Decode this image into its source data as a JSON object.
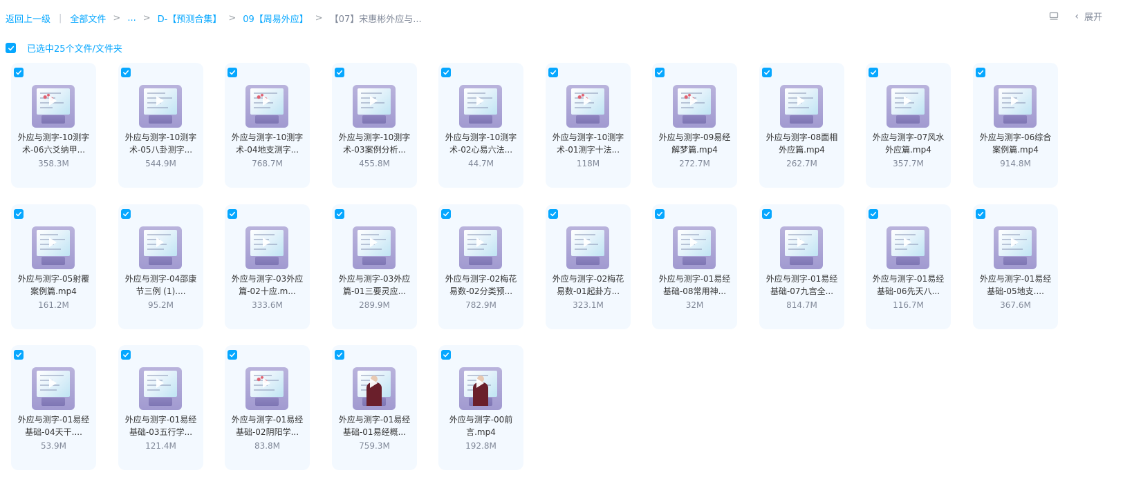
{
  "breadcrumb": {
    "back": "返回上一级",
    "all_files": "全部文件",
    "ellipsis": "...",
    "folder1": "D-【预测合集】",
    "folder2": "09【周易外应】",
    "current": "【07】宋惠彬外应与..."
  },
  "toolbar": {
    "collapse_label": "展开",
    "list_view_icon": "list-view-icon",
    "collapse_icon": "chevron-left-icon"
  },
  "selection": {
    "label": "已选中25个文件/文件夹",
    "checked": true
  },
  "colors": {
    "accent": "#06a7ff",
    "card_bg": "#f3f9ff",
    "muted": "#818999"
  },
  "files": [
    {
      "name": "外应与测字-10测字术-06六爻纳甲...",
      "size": "358.3M",
      "thumb": "slide-red"
    },
    {
      "name": "外应与测字-10测字术-05八卦测字...",
      "size": "544.9M",
      "thumb": "slide-play"
    },
    {
      "name": "外应与测字-10测字术-04地支测字...",
      "size": "768.7M",
      "thumb": "slide-red"
    },
    {
      "name": "外应与测字-10测字术-03案例分析...",
      "size": "455.8M",
      "thumb": "slide-play"
    },
    {
      "name": "外应与测字-10测字术-02心易六法...",
      "size": "44.7M",
      "thumb": "slide"
    },
    {
      "name": "外应与测字-10测字术-01测字十法...",
      "size": "118M",
      "thumb": "slide-red"
    },
    {
      "name": "外应与测字-09易经解梦篇.mp4",
      "size": "272.7M",
      "thumb": "slide-red"
    },
    {
      "name": "外应与测字-08面相外应篇.mp4",
      "size": "262.7M",
      "thumb": "slide-play"
    },
    {
      "name": "外应与测字-07风水外应篇.mp4",
      "size": "357.7M",
      "thumb": "slide"
    },
    {
      "name": "外应与测字-06综合案例篇.mp4",
      "size": "914.8M",
      "thumb": "slide"
    },
    {
      "name": "外应与测字-05射覆案例篇.mp4",
      "size": "161.2M",
      "thumb": "slide"
    },
    {
      "name": "外应与测字-04邵康节三例 (1)....",
      "size": "95.2M",
      "thumb": "slide"
    },
    {
      "name": "外应与测字-03外应篇-02十应.m...",
      "size": "333.6M",
      "thumb": "slide-play"
    },
    {
      "name": "外应与测字-03外应篇-01三要灵应...",
      "size": "289.9M",
      "thumb": "slide-play"
    },
    {
      "name": "外应与测字-02梅花易数-02分类预...",
      "size": "782.9M",
      "thumb": "slide-play"
    },
    {
      "name": "外应与测字-02梅花易数-01起卦方...",
      "size": "323.1M",
      "thumb": "slide"
    },
    {
      "name": "外应与测字-01易经基础-08常用神...",
      "size": "32M",
      "thumb": "slide"
    },
    {
      "name": "外应与测字-01易经基础-07九宫全...",
      "size": "814.7M",
      "thumb": "slide-play"
    },
    {
      "name": "外应与测字-01易经基础-06先天八...",
      "size": "116.7M",
      "thumb": "slide"
    },
    {
      "name": "外应与测字-01易经基础-05地支....",
      "size": "367.6M",
      "thumb": "slide"
    },
    {
      "name": "外应与测字-01易经基础-04天干....",
      "size": "53.9M",
      "thumb": "slide-play"
    },
    {
      "name": "外应与测字-01易经基础-03五行学...",
      "size": "121.4M",
      "thumb": "slide"
    },
    {
      "name": "外应与测字-01易经基础-02阴阳学...",
      "size": "83.8M",
      "thumb": "slide-red"
    },
    {
      "name": "外应与测字-01易经基础-01易经概...",
      "size": "759.3M",
      "thumb": "speaker"
    },
    {
      "name": "外应与测字-00前言.mp4",
      "size": "192.8M",
      "thumb": "speaker"
    }
  ]
}
